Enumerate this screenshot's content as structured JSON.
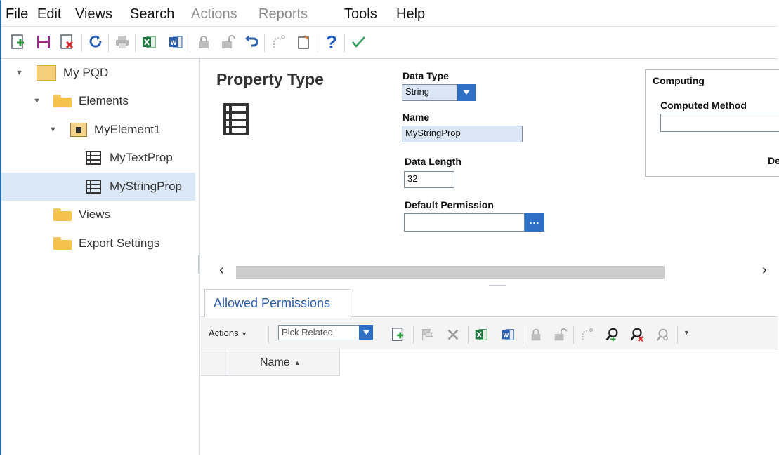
{
  "menu": {
    "items": [
      {
        "label": "File",
        "enabled": true
      },
      {
        "label": "Edit",
        "enabled": true
      },
      {
        "label": "Views",
        "enabled": true
      },
      {
        "label": "Search",
        "enabled": true
      },
      {
        "label": "Actions",
        "enabled": false
      },
      {
        "label": "Reports",
        "enabled": false
      },
      {
        "label": "Tools",
        "enabled": true
      },
      {
        "label": "Help",
        "enabled": true
      }
    ]
  },
  "toolbar": {
    "icons": [
      "new-icon",
      "save-icon",
      "delete-icon",
      "refresh-icon",
      "print-icon",
      "excel-icon",
      "word-icon",
      "lock-icon",
      "unlock-icon",
      "undo-icon",
      "redo-icon",
      "paste-icon",
      "help-icon",
      "check-icon"
    ]
  },
  "tree": {
    "root": "My PQD",
    "elements": "Elements",
    "element1": "MyElement1",
    "prop1": "MyTextProp",
    "prop2": "MyStringProp",
    "views": "Views",
    "export": "Export Settings"
  },
  "props": {
    "title": "Property Type",
    "data_type_label": "Data Type",
    "data_type_value": "String",
    "name_label": "Name",
    "name_value": "MyStringProp",
    "data_length_label": "Data Length",
    "data_length_value": "32",
    "default_permission_label": "Default Permission",
    "default_permission_value": "",
    "computing_label": "Computing",
    "computed_method_label": "Computed Method",
    "computed_method_value": "",
    "truncated_label": "De"
  },
  "lower": {
    "tab_label": "Allowed Permissions",
    "actions_label": "Actions",
    "pick_related_label": "Pick Related",
    "name_column": "Name"
  },
  "colors": {
    "accent": "#2f6fc4",
    "selection": "#dbe8f7",
    "folder": "#f5c24e",
    "excel": "#1f7a3f",
    "word": "#2b5fb0"
  }
}
